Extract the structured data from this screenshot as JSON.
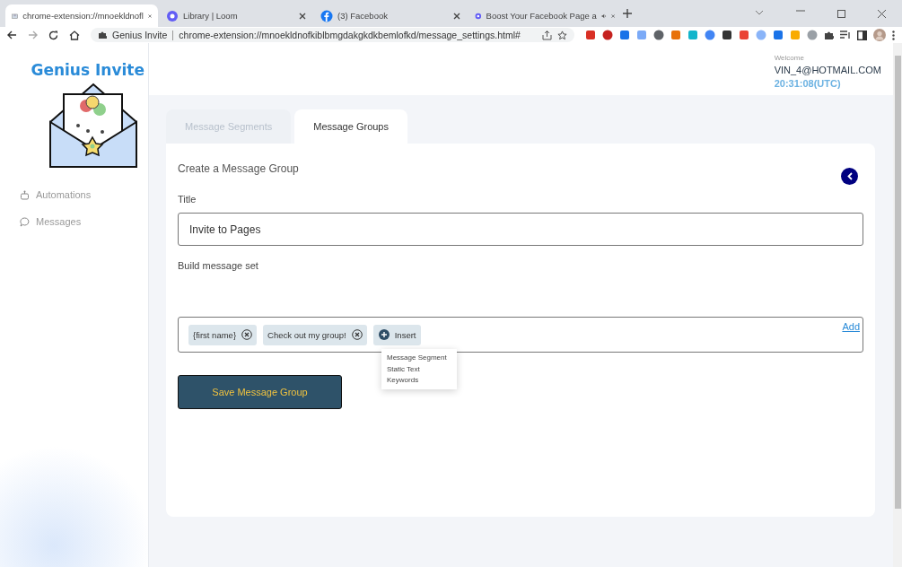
{
  "browser": {
    "tabs": [
      {
        "title": "chrome-extension://mnoekldnofl",
        "selected": true,
        "audio": false
      },
      {
        "title": "Library | Loom",
        "selected": false,
        "audio": false
      },
      {
        "title": "(3) Facebook",
        "selected": false,
        "audio": false
      },
      {
        "title": "Boost Your Facebook Page a",
        "selected": false,
        "audio": true
      }
    ],
    "site": "Genius Invite",
    "url": "chrome-extension://mnoekldnofkiblbmgdakgkdkbemlofkd/message_settings.html#"
  },
  "sidebar": {
    "logo": "Genius Invite",
    "items": [
      {
        "label": "Automations",
        "selected": false
      },
      {
        "label": "Messages",
        "selected": false
      }
    ]
  },
  "header": {
    "welcome": "Welcome",
    "user": "VIN_4@HOTMAIL.COM",
    "time": "20:31:08(UTC)"
  },
  "tabs": [
    {
      "label": "Message Segments",
      "selected": false
    },
    {
      "label": "Message Groups",
      "selected": true
    }
  ],
  "form": {
    "heading": "Create a Message Group",
    "title_label": "Title",
    "title_value": "Invite to Pages",
    "build_label": "Build message set",
    "chips": [
      {
        "text": "{first name}"
      },
      {
        "text": "Check out my group!"
      }
    ],
    "insert": "Insert",
    "add": "Add",
    "menu": [
      {
        "label": "Message Segment"
      },
      {
        "label": "Static Text"
      },
      {
        "label": "Keywords"
      }
    ],
    "save": "Save Message Group"
  }
}
